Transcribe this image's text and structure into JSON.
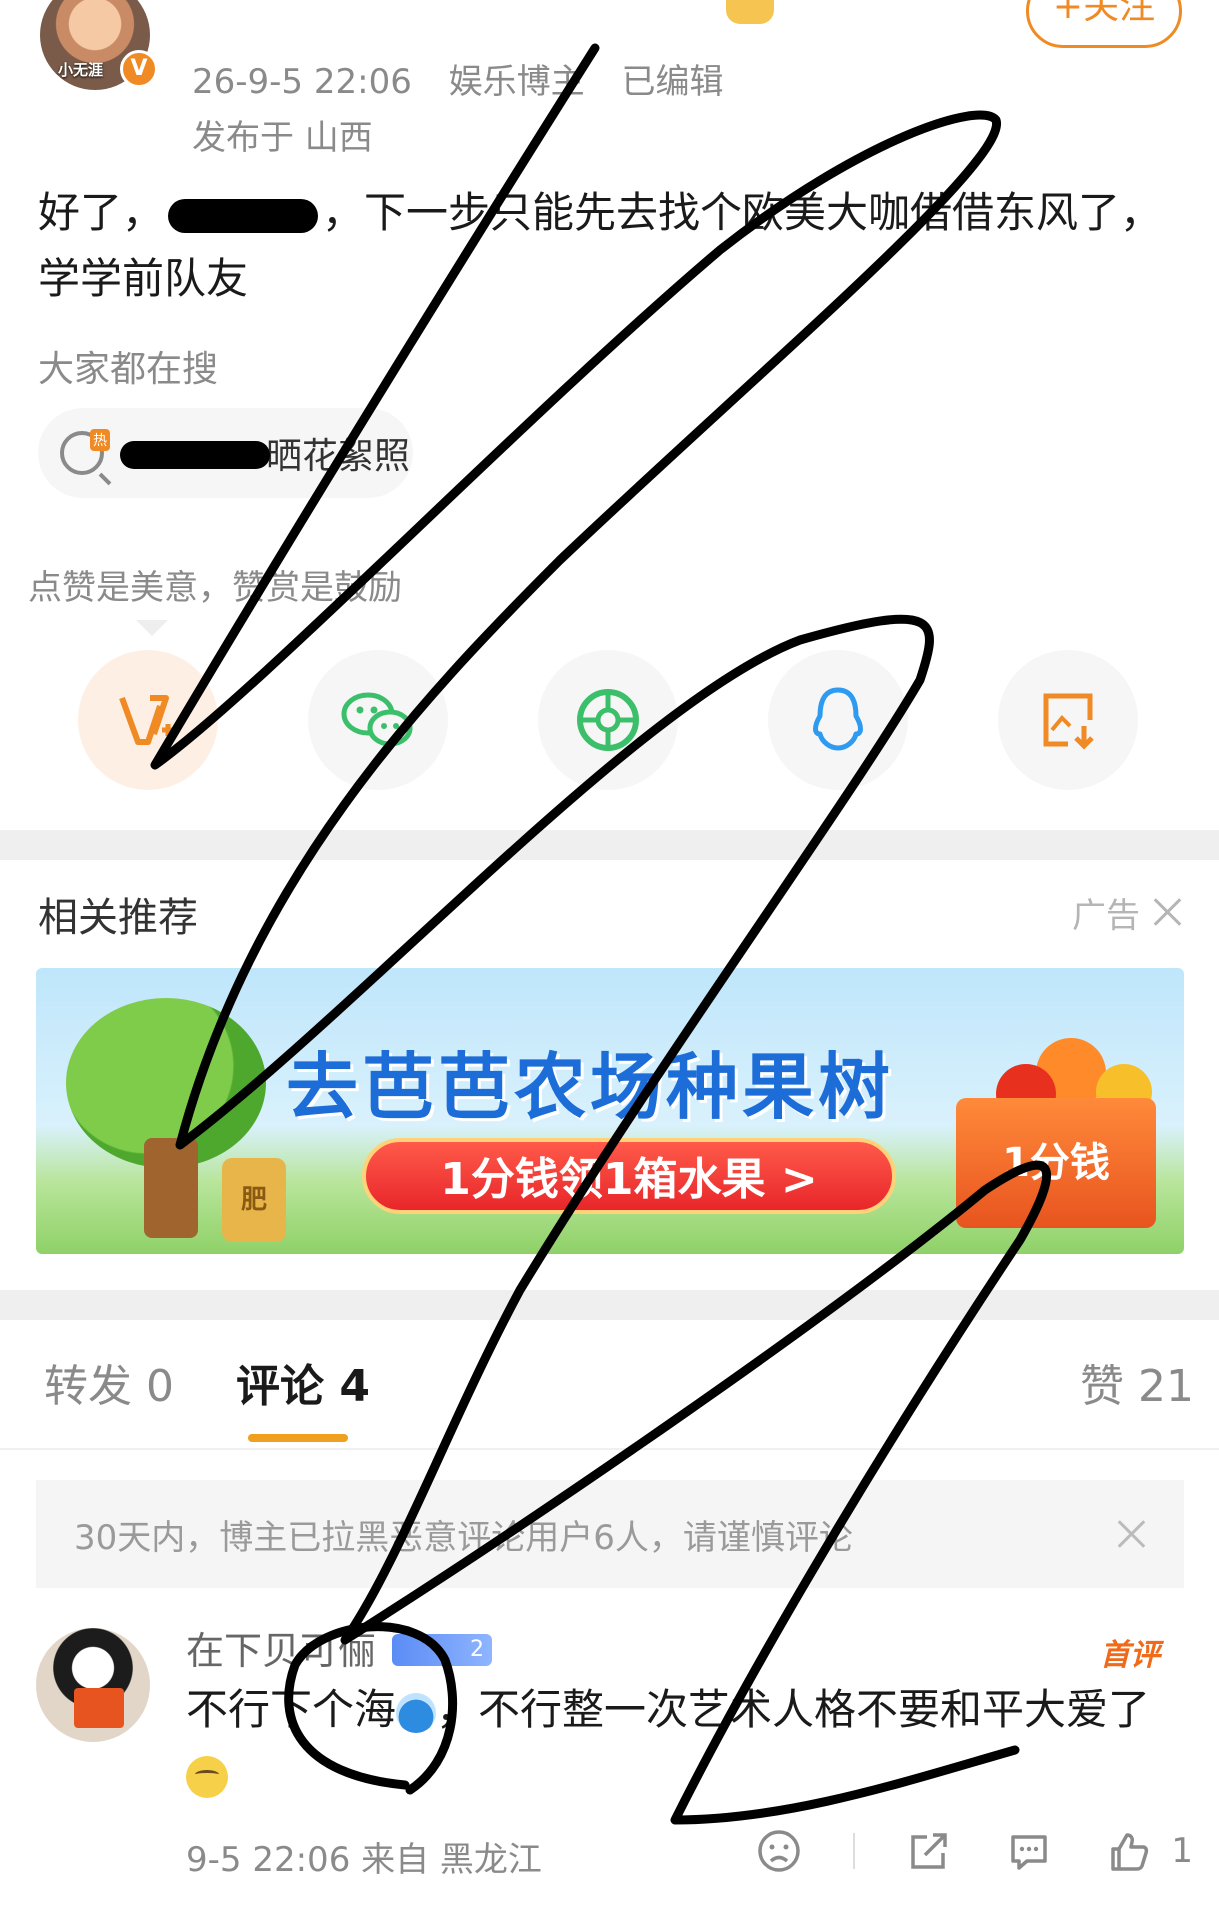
{
  "post": {
    "author_name": "",
    "follow_label": "+关注",
    "meta": {
      "time": "26-9-5 22:06",
      "role": "娱乐博主",
      "edited": "已编辑"
    },
    "location": "发布于 山西",
    "text_before": "好了，",
    "text_after": "，下一步只能先去找个欧美大咖借借东风了，学学前队友",
    "avatar_caption": "小无涯"
  },
  "search": {
    "title": "大家都在搜",
    "chip_text": "晒花絮照",
    "hot_tag": "热"
  },
  "reward_tip": "点赞是美意，赞赏是鼓励",
  "share": [
    "vip-reward-icon",
    "wechat-icon",
    "moments-icon",
    "qq-icon",
    "save-image-icon"
  ],
  "recommend": {
    "title": "相关推荐",
    "ad_label": "广告",
    "ad_headline": "去芭芭农场种果树",
    "ad_cta": "1分钱领1箱水果 >",
    "ad_box": "1分钱",
    "ad_barrel": "肥"
  },
  "tabs": [
    {
      "label": "转发 0"
    },
    {
      "label": "评论 4"
    },
    {
      "label": "赞 21"
    }
  ],
  "notice": "30天内，博主已拉黑恶意评论用户6人，请谨慎评论",
  "comment": {
    "author_name": "在下贝可俪",
    "level": "2",
    "first_badge": "首评",
    "text_a": "不行下个海",
    "text_b": "，不行整一次艺术人格不要和平大爱了",
    "meta": "9-5 22:06 来自 黑龙江",
    "like_count": "1"
  },
  "colors": {
    "accent": "#f08a24",
    "link_orange": "#f06a1a",
    "tab_underline": "#f0a020",
    "ad_blue": "#1c6dd8"
  }
}
